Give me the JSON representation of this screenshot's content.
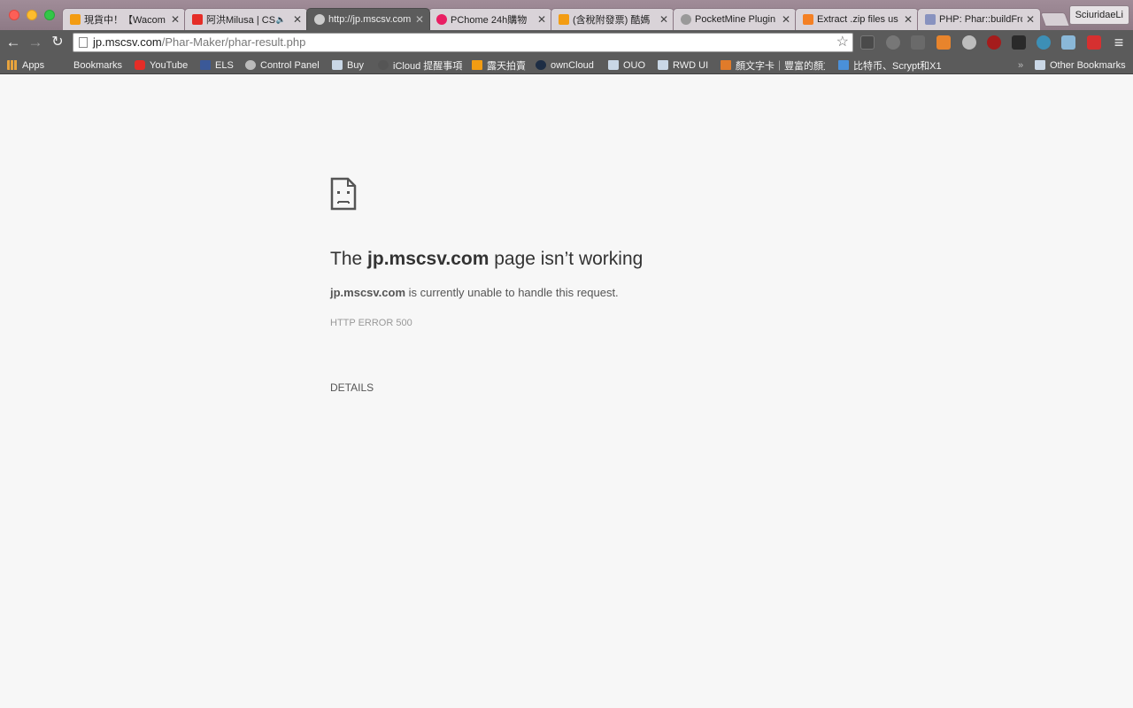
{
  "window": {
    "profile_name": "SciuridaeLi"
  },
  "tabs": [
    {
      "title": "現貨中！【Wacom",
      "icon": "ruten-icon",
      "color": "#f39c12",
      "active": false
    },
    {
      "title": "阿洪Milusa | CS",
      "icon": "youtube-icon",
      "color": "#e52d27",
      "active": false,
      "audio": true
    },
    {
      "title": "http://jp.mscsv.com",
      "icon": "globe-icon",
      "color": "#cccccc",
      "active": true
    },
    {
      "title": "PChome 24h購物",
      "icon": "pchome-icon",
      "color": "#e91e63",
      "active": false
    },
    {
      "title": "(含稅附發票) 酷媽",
      "icon": "ruten-icon",
      "color": "#f39c12",
      "active": false
    },
    {
      "title": "PocketMine Plugin",
      "icon": "pocketmine-icon",
      "color": "#999999",
      "active": false
    },
    {
      "title": "Extract .zip files us",
      "icon": "stackoverflow-icon",
      "color": "#f48024",
      "active": false
    },
    {
      "title": "PHP: Phar::buildFro",
      "icon": "php-icon",
      "color": "#8892bf",
      "active": false
    }
  ],
  "toolbar": {
    "url_host": "jp.mscsv.com",
    "url_path": "/Phar-Maker/phar-result.php",
    "star_glyph": "☆",
    "back_glyph": "←",
    "forward_glyph": "→",
    "reload_glyph": "↻",
    "menu_glyph": "≡"
  },
  "bookmarks": [
    {
      "label": "Apps",
      "icon": "apps-grid-icon",
      "color": "#e8a33d"
    },
    {
      "label": "Bookmarks",
      "icon": "bookmarks-icon",
      "color": "#5b5b5b"
    },
    {
      "label": "YouTube",
      "icon": "youtube-icon",
      "color": "#e52d27"
    },
    {
      "label": "ELS",
      "icon": "facebook-icon",
      "color": "#3b5998"
    },
    {
      "label": "Control Panel",
      "icon": "control-panel-icon",
      "color": "#bbbbbb"
    },
    {
      "label": "Buy",
      "icon": "folder-icon",
      "color": "#c9d7e6"
    },
    {
      "label": "iCloud 提醒事項",
      "icon": "apple-icon",
      "color": "#555555"
    },
    {
      "label": "露天拍賣",
      "icon": "ruten-icon",
      "color": "#f39c12"
    },
    {
      "label": "ownCloud",
      "icon": "owncloud-icon",
      "color": "#1d2d44"
    },
    {
      "label": "OUO",
      "icon": "folder-icon",
      "color": "#c9d7e6"
    },
    {
      "label": "RWD UI",
      "icon": "folder-icon",
      "color": "#c9d7e6"
    },
    {
      "label": "顏文字卡｜豐富的顏文",
      "icon": "kaomoji-icon",
      "color": "#e07b2a"
    },
    {
      "label": "比特币、Scrypt和X1",
      "icon": "chart-icon",
      "color": "#4a90d9"
    },
    {
      "label": "»",
      "icon": "",
      "color": ""
    },
    {
      "label": "Other Bookmarks",
      "icon": "folder-icon",
      "color": "#c9d7e6"
    }
  ],
  "error": {
    "heading_prefix": "The ",
    "heading_host": "jp.mscsv.com",
    "heading_suffix": " page isn’t working",
    "desc_host": "jp.mscsv.com",
    "desc_suffix": " is currently unable to handle this request.",
    "code": "HTTP ERROR 500",
    "details_label": "DETAILS"
  }
}
